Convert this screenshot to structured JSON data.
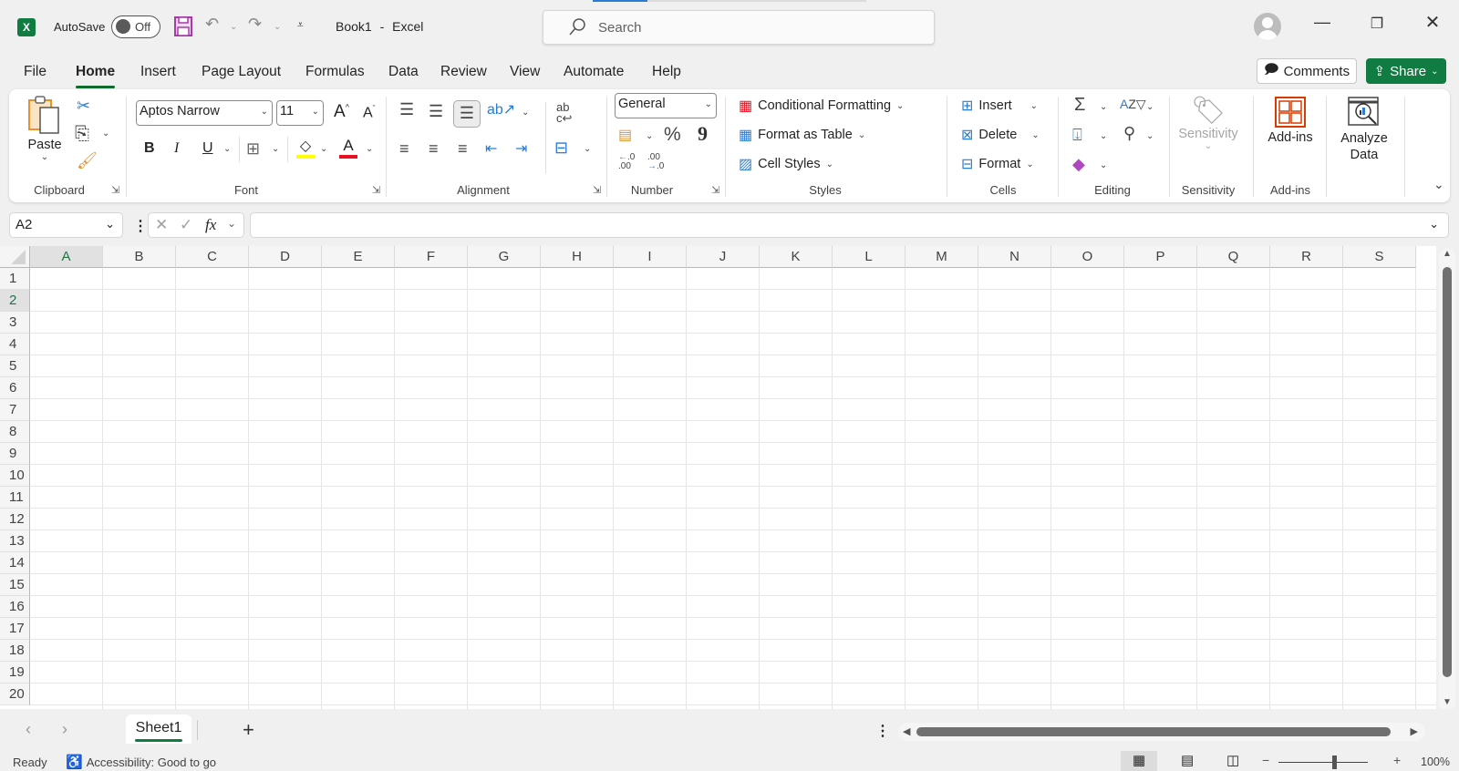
{
  "app": {
    "doc_name": "Book1",
    "app_name": "Excel",
    "title_separator": "-",
    "autosave_label": "AutoSave",
    "autosave_state": "Off",
    "search_placeholder": "Search"
  },
  "menu": {
    "tabs": [
      "File",
      "Home",
      "Insert",
      "Page Layout",
      "Formulas",
      "Data",
      "Review",
      "View",
      "Automate",
      "Help"
    ],
    "active": "Home",
    "comments_label": "Comments",
    "share_label": "Share"
  },
  "ribbon": {
    "clipboard": {
      "label": "Clipboard",
      "paste_label": "Paste"
    },
    "font": {
      "label": "Font",
      "font_name": "Aptos Narrow",
      "font_size": "11",
      "bold": "B",
      "italic": "I",
      "underline": "U"
    },
    "alignment": {
      "label": "Alignment"
    },
    "number": {
      "label": "Number",
      "format": "General",
      "percent": "%",
      "comma": "9"
    },
    "styles": {
      "label": "Styles",
      "items": [
        "Conditional Formatting",
        "Format as Table",
        "Cell Styles"
      ]
    },
    "cells": {
      "label": "Cells",
      "items": [
        "Insert",
        "Delete",
        "Format"
      ]
    },
    "editing": {
      "label": "Editing"
    },
    "sensitivity": {
      "label": "Sensitivity",
      "button_label": "Sensitivity"
    },
    "addins": {
      "label": "Add-ins",
      "button_label": "Add-ins"
    },
    "analyze": {
      "button_label_1": "Analyze",
      "button_label_2": "Data"
    }
  },
  "formula_bar": {
    "name_box": "A2",
    "formula": "",
    "fx": "fx"
  },
  "grid": {
    "columns": [
      "A",
      "B",
      "C",
      "D",
      "E",
      "F",
      "G",
      "H",
      "I",
      "J",
      "K",
      "L",
      "M",
      "N",
      "O",
      "P",
      "Q",
      "R",
      "S"
    ],
    "rows": [
      "1",
      "2",
      "3",
      "4",
      "5",
      "6",
      "7",
      "8",
      "9",
      "10",
      "11",
      "12",
      "13",
      "14",
      "15",
      "16",
      "17",
      "18",
      "19",
      "20"
    ],
    "selected_column": "A",
    "selected_row": "2"
  },
  "sheets": {
    "tabs": [
      "Sheet1"
    ],
    "active": "Sheet1",
    "add_label": "+"
  },
  "status": {
    "ready": "Ready",
    "accessibility": "Accessibility: Good to go",
    "zoom": "100%",
    "zoom_level_percent": 100
  },
  "colors": {
    "accent": "#107c41",
    "selected_header": "#217346"
  }
}
